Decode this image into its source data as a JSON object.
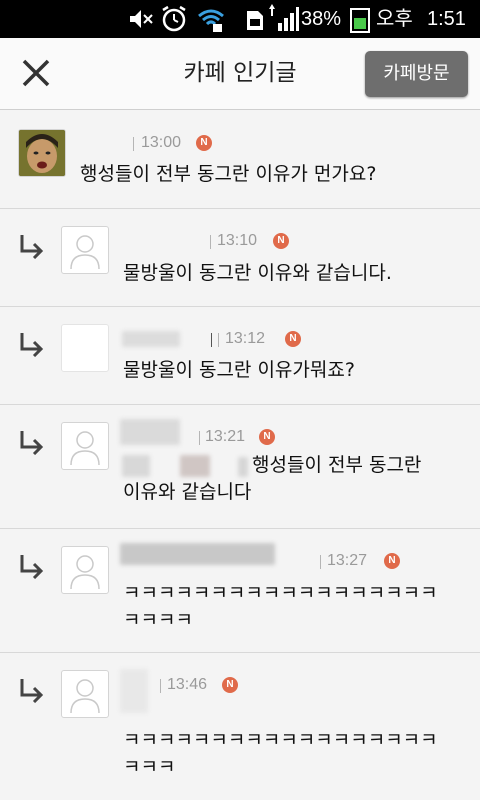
{
  "status_bar": {
    "battery_percent": "38%",
    "ampm": "오후",
    "time": "1:51",
    "icons": [
      "mute-icon",
      "alarm-icon",
      "wifi-icon",
      "sd-card-icon",
      "signal-icon",
      "battery-icon"
    ]
  },
  "header": {
    "title": "카페 인기글",
    "visit_button": "카페방문",
    "close_icon": "close-icon"
  },
  "posts": [
    {
      "time": "13:00",
      "badge": "N",
      "text_lines": [
        "행성들이 전부 동그란 이유가 먼가요?"
      ]
    },
    {
      "time": "13:10",
      "badge": "N",
      "text_lines": [
        "물방울이 동그란 이유와 같습니다."
      ]
    },
    {
      "time": "13:12",
      "badge": "N",
      "text_lines": [
        "물방울이 동그란 이유가뭐죠?"
      ]
    },
    {
      "time": "13:21",
      "badge": "N",
      "text_lines": [
        "행성들이 전부 동그란",
        "이유와 같습니다"
      ]
    },
    {
      "time": "13:27",
      "badge": "N",
      "text_lines": [
        "ㅋㅋㅋㅋㅋㅋㅋㅋㅋㅋㅋㅋㅋㅋㅋㅋㅋㅋ",
        "ㅋㅋㅋㅋ"
      ]
    },
    {
      "time": "13:46",
      "badge": "N",
      "text_lines": [
        "ㅋㅋㅋㅋㅋㅋㅋㅋㅋㅋㅋㅋㅋㅋㅋㅋㅋㅋ",
        "ㅋㅋㅋ"
      ]
    }
  ],
  "colors": {
    "badge": "#e06a4a",
    "visit_button": "#6e6e6e",
    "status_bar": "#000000"
  }
}
